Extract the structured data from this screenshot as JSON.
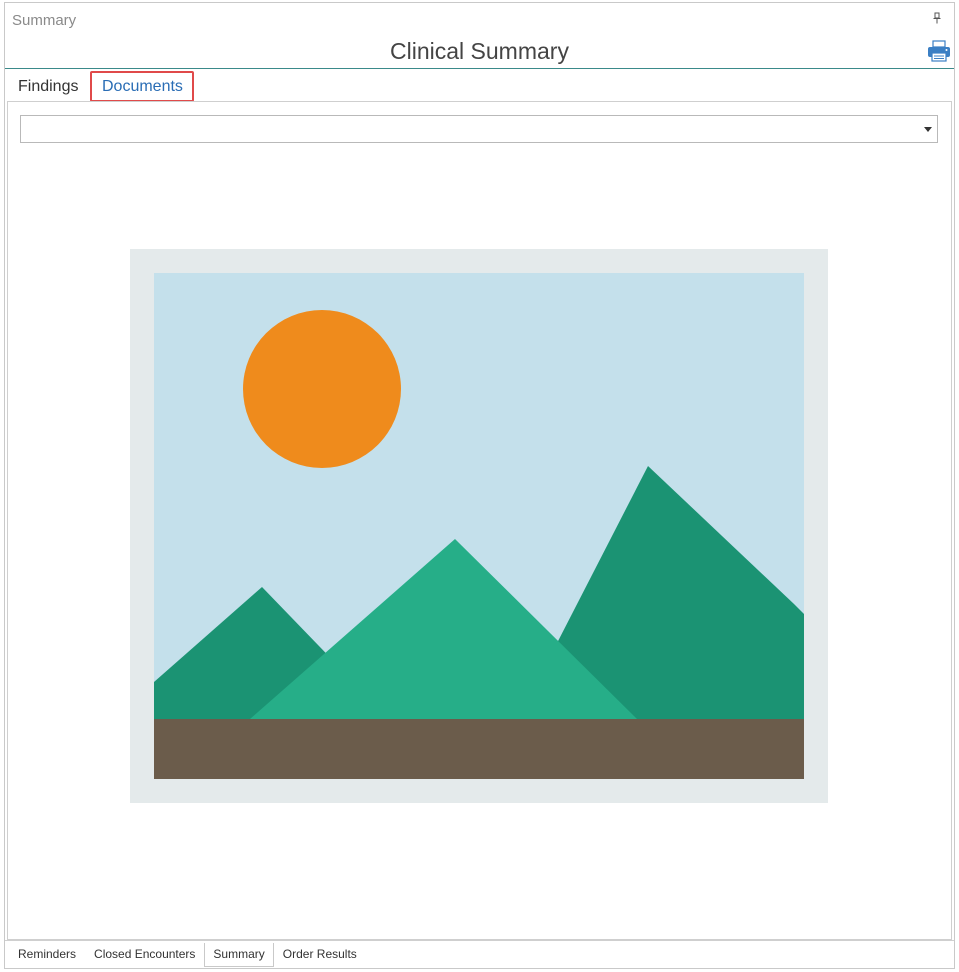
{
  "panel": {
    "title": "Summary"
  },
  "header": {
    "title": "Clinical Summary",
    "print_icon": "printer-icon",
    "pin_icon": "pin-icon"
  },
  "tabs": [
    {
      "label": "Findings",
      "active": false
    },
    {
      "label": "Documents",
      "active": true,
      "highlighted": true
    }
  ],
  "document_selector": {
    "value": "",
    "icon": "chevron-down-icon"
  },
  "document_preview": {
    "icon": "image-placeholder-icon",
    "colors": {
      "frame": "#e4eaeb",
      "sky": "#c4e0eb",
      "sun": "#ef8b1c",
      "mountain_dark": "#1b9373",
      "mountain_light": "#26ae88",
      "ground": "#6b5c4b"
    }
  },
  "bottom_tabs": [
    {
      "label": "Reminders",
      "active": false
    },
    {
      "label": "Closed Encounters",
      "active": false
    },
    {
      "label": "Summary",
      "active": true
    },
    {
      "label": "Order Results",
      "active": false
    }
  ],
  "colors": {
    "accent": "#2a6db5",
    "title_rule": "#3a8a8a",
    "highlight": "#e04a4a"
  }
}
